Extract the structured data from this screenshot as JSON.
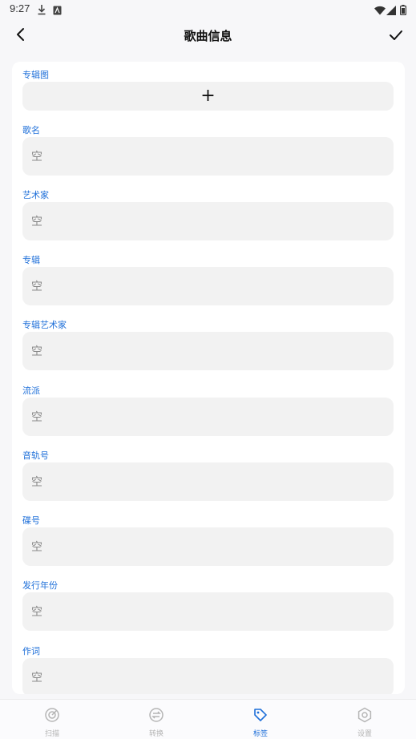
{
  "status_bar": {
    "time": "9:27"
  },
  "header": {
    "title": "歌曲信息"
  },
  "form": {
    "album_art_label": "专辑图",
    "album_art_add": "+",
    "fields": [
      {
        "label": "歌名",
        "value": "空"
      },
      {
        "label": "艺术家",
        "value": "空"
      },
      {
        "label": "专辑",
        "value": "空"
      },
      {
        "label": "专辑艺术家",
        "value": "空"
      },
      {
        "label": "流派",
        "value": "空"
      },
      {
        "label": "音轨号",
        "value": "空"
      },
      {
        "label": "碟号",
        "value": "空"
      },
      {
        "label": "发行年份",
        "value": "空"
      },
      {
        "label": "作词",
        "value": "空"
      }
    ]
  },
  "bottom_nav": {
    "items": [
      {
        "label": "扫描",
        "icon": "scan-icon",
        "active": false
      },
      {
        "label": "转换",
        "icon": "convert-icon",
        "active": false
      },
      {
        "label": "标签",
        "icon": "tag-icon",
        "active": true
      },
      {
        "label": "设置",
        "icon": "settings-icon",
        "active": false
      }
    ]
  },
  "colors": {
    "accent": "#1e6fd9",
    "field_bg": "#f2f2f2",
    "page_bg": "#f7f7f9"
  }
}
